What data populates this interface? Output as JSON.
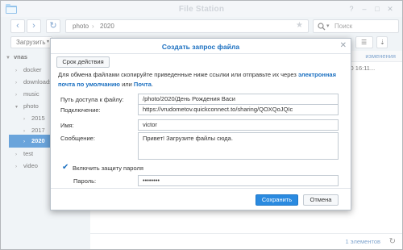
{
  "app": {
    "title": "File Station"
  },
  "nav": {
    "path": [
      "photo",
      "2020"
    ],
    "search_placeholder": "Поиск"
  },
  "toolbar": {
    "upload_label": "Загрузить"
  },
  "sidebar": {
    "items": [
      {
        "label": "vnas",
        "level": 0,
        "arrow": "▼"
      },
      {
        "label": "docker",
        "level": 1,
        "arrow": "›"
      },
      {
        "label": "downloads",
        "level": 1,
        "arrow": "›"
      },
      {
        "label": "music",
        "level": 1,
        "arrow": "›"
      },
      {
        "label": "photo",
        "level": 1,
        "arrow": "▾"
      },
      {
        "label": "2015",
        "level": 2,
        "arrow": "›"
      },
      {
        "label": "2017",
        "level": 2,
        "arrow": "›"
      },
      {
        "label": "2020",
        "level": 2,
        "arrow": "›",
        "selected": true
      },
      {
        "label": "test",
        "level": 1,
        "arrow": "›"
      },
      {
        "label": "video",
        "level": 1,
        "arrow": "›"
      }
    ]
  },
  "main": {
    "column_modified": "изменения",
    "row_modified": "2020 16:11...",
    "item_count": "1 элементов"
  },
  "dialog": {
    "title": "Создать запрос файла",
    "tab_validity": "Срок действия",
    "desc_text": "Для обмена файлами скопируйте приведенные ниже ссылки или отправьте их через",
    "desc_link_email": "электронная почта по умолчанию",
    "desc_or": "или",
    "desc_link_mail": "Почта",
    "desc_end": ".",
    "fields": {
      "path_label": "Путь доступа к файлу:",
      "path_value": "/photo/2020/День Рождения Васи",
      "link_label": "Подключение:",
      "link_value": "https://vrudometov.quickconnect.to/sharing/QOXQoJQIc",
      "name_label": "Имя:",
      "name_value": "victor",
      "message_label": "Сообщение:",
      "message_value": "Привет! Загрузите файлы сюда.",
      "password_checkbox_label": "Включить защиту пароля",
      "password_label": "Пароль:",
      "password_value": "••••••••"
    },
    "save_label": "Сохранить",
    "cancel_label": "Отмена"
  }
}
